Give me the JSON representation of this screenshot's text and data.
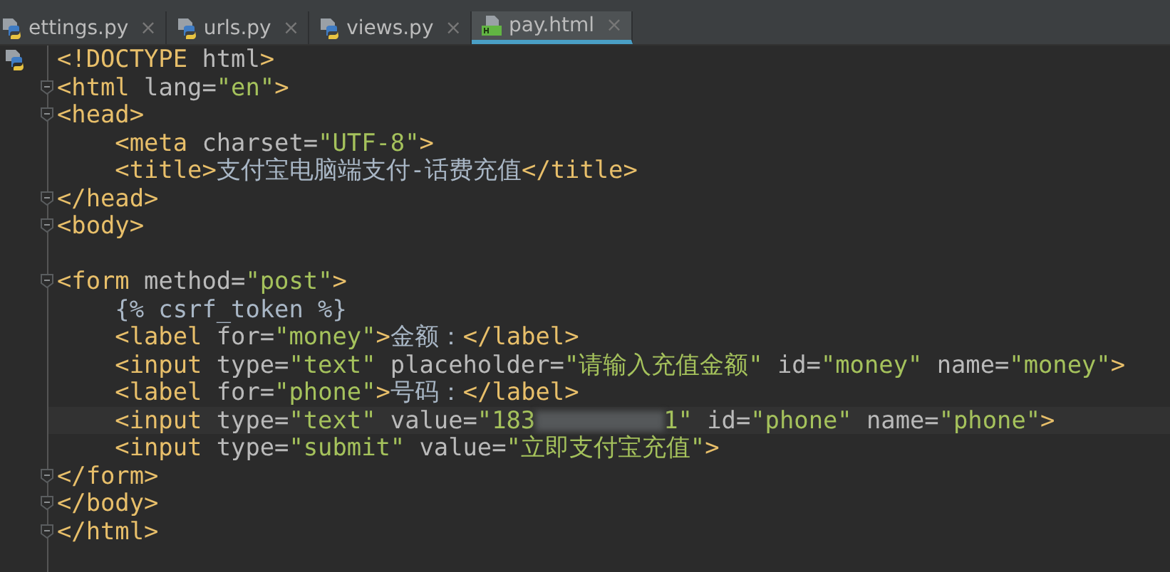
{
  "tabs": [
    {
      "label": "ettings.py",
      "kind": "py",
      "close": "×",
      "selected": false
    },
    {
      "label": "urls.py",
      "kind": "py",
      "close": "×",
      "selected": false
    },
    {
      "label": "views.py",
      "kind": "py",
      "close": "×",
      "selected": false
    },
    {
      "label": "pay.html",
      "kind": "html",
      "close": "×",
      "selected": true
    }
  ],
  "lines": [
    {
      "fold": false,
      "current": false,
      "tokens": [
        {
          "kind": "tag",
          "text": "<!DOCTYPE"
        },
        {
          "kind": "attr",
          "text": " html"
        },
        {
          "kind": "tag",
          "text": ">"
        }
      ]
    },
    {
      "fold": true,
      "current": false,
      "tokens": [
        {
          "kind": "tag",
          "text": "<html"
        },
        {
          "kind": "attr",
          "text": " lang="
        },
        {
          "kind": "string",
          "text": "\"en\""
        },
        {
          "kind": "tag",
          "text": ">"
        }
      ]
    },
    {
      "fold": true,
      "current": false,
      "tokens": [
        {
          "kind": "tag",
          "text": "<head>"
        }
      ]
    },
    {
      "fold": false,
      "current": false,
      "tokens": [
        {
          "kind": "tag",
          "text": "    <meta"
        },
        {
          "kind": "attr",
          "text": " charset="
        },
        {
          "kind": "string",
          "text": "\"UTF-8\""
        },
        {
          "kind": "tag",
          "text": ">"
        }
      ]
    },
    {
      "fold": false,
      "current": false,
      "tokens": [
        {
          "kind": "tag",
          "text": "    <title>"
        },
        {
          "kind": "text",
          "text": "支付宝电脑端支付-话费充值"
        },
        {
          "kind": "tag",
          "text": "</title>"
        }
      ]
    },
    {
      "fold": true,
      "current": false,
      "tokens": [
        {
          "kind": "tag",
          "text": "</head>"
        }
      ]
    },
    {
      "fold": true,
      "current": false,
      "tokens": [
        {
          "kind": "tag",
          "text": "<body>"
        }
      ]
    },
    {
      "fold": false,
      "current": false
    },
    {
      "fold": true,
      "current": false,
      "tokens": [
        {
          "kind": "tag",
          "text": "<form"
        },
        {
          "kind": "attr",
          "text": " method="
        },
        {
          "kind": "string",
          "text": "\"post\""
        },
        {
          "kind": "tag",
          "text": ">"
        }
      ]
    },
    {
      "fold": false,
      "current": false,
      "tokens": [
        {
          "kind": "text",
          "text": "    {% csrf_token %}"
        }
      ]
    },
    {
      "fold": false,
      "current": false,
      "tokens": [
        {
          "kind": "tag",
          "text": "    <label"
        },
        {
          "kind": "attr",
          "text": " for="
        },
        {
          "kind": "string",
          "text": "\"money\""
        },
        {
          "kind": "tag",
          "text": ">"
        },
        {
          "kind": "text",
          "text": "金额："
        },
        {
          "kind": "tag",
          "text": "</label>"
        }
      ]
    },
    {
      "fold": false,
      "current": false,
      "tokens": [
        {
          "kind": "tag",
          "text": "    <input"
        },
        {
          "kind": "attr",
          "text": " type="
        },
        {
          "kind": "string",
          "text": "\"text\""
        },
        {
          "kind": "attr",
          "text": " placeholder="
        },
        {
          "kind": "string",
          "text": "\"请输入充值金额\""
        },
        {
          "kind": "attr",
          "text": " id="
        },
        {
          "kind": "string",
          "text": "\"money\""
        },
        {
          "kind": "attr",
          "text": " name="
        },
        {
          "kind": "string",
          "text": "\"money\""
        },
        {
          "kind": "tag",
          "text": ">"
        }
      ]
    },
    {
      "fold": false,
      "current": false,
      "tokens": [
        {
          "kind": "tag",
          "text": "    <label"
        },
        {
          "kind": "attr",
          "text": " for="
        },
        {
          "kind": "string",
          "text": "\"phone\""
        },
        {
          "kind": "tag",
          "text": ">"
        },
        {
          "kind": "text",
          "text": "号码："
        },
        {
          "kind": "tag",
          "text": "</label>"
        }
      ]
    },
    {
      "fold": false,
      "current": true,
      "tokens": [
        {
          "kind": "tag",
          "text": "    <input"
        },
        {
          "kind": "attr",
          "text": " type="
        },
        {
          "kind": "string",
          "text": "\"text\""
        },
        {
          "kind": "attr",
          "text": " value="
        },
        {
          "kind": "string",
          "text": "\"183"
        },
        {
          "kind": "redacted"
        },
        {
          "kind": "string",
          "text": "1\""
        },
        {
          "kind": "attr",
          "text": " id="
        },
        {
          "kind": "string",
          "text": "\"phone\""
        },
        {
          "kind": "attr",
          "text": " name="
        },
        {
          "kind": "string",
          "text": "\"phone\""
        },
        {
          "kind": "tag",
          "text": ">"
        }
      ]
    },
    {
      "fold": false,
      "current": false,
      "tokens": [
        {
          "kind": "tag",
          "text": "    <input"
        },
        {
          "kind": "attr",
          "text": " type="
        },
        {
          "kind": "string",
          "text": "\"submit\""
        },
        {
          "kind": "attr",
          "text": " value="
        },
        {
          "kind": "string",
          "text": "\"立即支付宝充值\""
        },
        {
          "kind": "tag",
          "text": ">"
        }
      ]
    },
    {
      "fold": true,
      "current": false,
      "tokens": [
        {
          "kind": "tag",
          "text": "</form>"
        }
      ]
    },
    {
      "fold": true,
      "current": false,
      "tokens": [
        {
          "kind": "tag",
          "text": "</body>"
        }
      ]
    },
    {
      "fold": true,
      "current": false,
      "tokens": [
        {
          "kind": "tag",
          "text": "</html>"
        }
      ]
    }
  ]
}
